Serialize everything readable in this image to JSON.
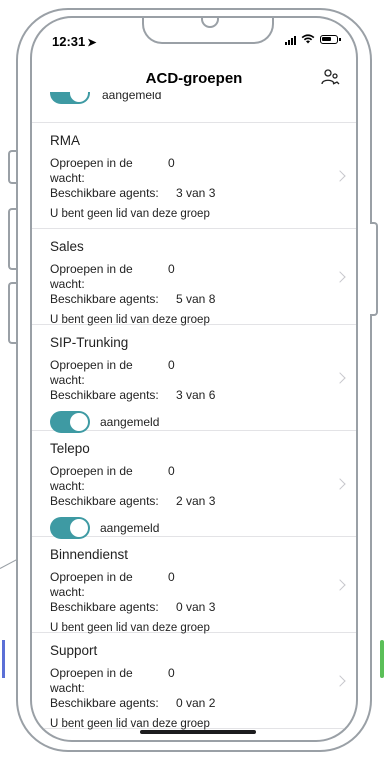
{
  "status": {
    "time": "12:31"
  },
  "nav": {
    "title": "ACD-groepen"
  },
  "partial_group": {
    "toggle_label": "aangemeld"
  },
  "groups": [
    {
      "name": "RMA",
      "waiting_label": "Oproepen in de wacht:",
      "waiting": "0",
      "agents_label": "Beschikbare agents:",
      "agents": "3 van 3",
      "membership": "U bent geen lid van deze groep",
      "toggle": false
    },
    {
      "name": "Sales",
      "waiting_label": "Oproepen in de wacht:",
      "waiting": "0",
      "agents_label": "Beschikbare agents:",
      "agents": "5 van 8",
      "membership": "U bent geen lid van deze groep",
      "toggle": false
    },
    {
      "name": "SIP-Trunking",
      "waiting_label": "Oproepen in de wacht:",
      "waiting": "0",
      "agents_label": "Beschikbare agents:",
      "agents": "3 van 6",
      "toggle": true,
      "toggle_label": "aangemeld"
    },
    {
      "name": "Telepo",
      "waiting_label": "Oproepen in de wacht:",
      "waiting": "0",
      "agents_label": "Beschikbare agents:",
      "agents": "2 van 3",
      "toggle": true,
      "toggle_label": "aangemeld"
    },
    {
      "name": "Binnendienst",
      "waiting_label": "Oproepen in de wacht:",
      "waiting": "0",
      "agents_label": "Beschikbare agents:",
      "agents": "0 van 3",
      "membership": "U bent geen lid van deze groep",
      "toggle": false
    },
    {
      "name": "Support",
      "waiting_label": "Oproepen in de wacht:",
      "waiting": "0",
      "agents_label": "Beschikbare agents:",
      "agents": "0 van 2",
      "membership": "U bent geen lid van deze groep",
      "toggle": false
    }
  ],
  "colors": {
    "toggle_on": "#3e9aa3",
    "accent_left": "#5b6fd6",
    "accent_right": "#5bbf58"
  },
  "icons": {
    "nav_action": "agents-icon",
    "location": "location-arrow-icon",
    "chevron": "chevron-right-icon"
  }
}
